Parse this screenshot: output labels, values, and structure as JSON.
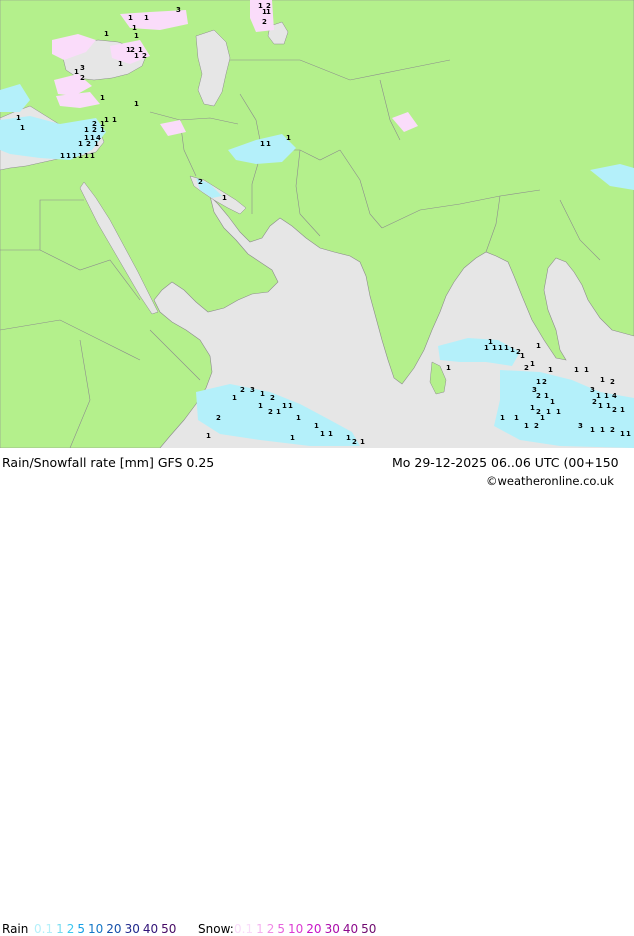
{
  "title": "Rain/Snowfall rate [mm] GFS 0.25",
  "valid_time": "Mo 29-12-2025 06..06 UTC (00+150",
  "credit": "©weatheronline.co.uk",
  "legend": {
    "rain_label": "Rain",
    "rain_values": [
      {
        "text": "0.1",
        "color": "#b4f0fa"
      },
      {
        "text": "1",
        "color": "#78dcf0"
      },
      {
        "text": "2",
        "color": "#3cc8f0"
      },
      {
        "text": "5",
        "color": "#14a0e6"
      },
      {
        "text": "10",
        "color": "#1478c8"
      },
      {
        "text": "20",
        "color": "#1450aa"
      },
      {
        "text": "30",
        "color": "#1e288c"
      },
      {
        "text": "40",
        "color": "#321478"
      },
      {
        "text": "50",
        "color": "#460a64"
      }
    ],
    "snow_label": "Snow:",
    "snow_values": [
      {
        "text": "0.1",
        "color": "#fadcfa"
      },
      {
        "text": "1",
        "color": "#f5b4f0"
      },
      {
        "text": "2",
        "color": "#f08ce6"
      },
      {
        "text": "5",
        "color": "#e664dc"
      },
      {
        "text": "10",
        "color": "#dc3cd2"
      },
      {
        "text": "20",
        "color": "#c814c8"
      },
      {
        "text": "30",
        "color": "#aa0aaa"
      },
      {
        "text": "40",
        "color": "#8c0a8c"
      },
      {
        "text": "50",
        "color": "#6e0a6e"
      }
    ]
  },
  "colors": {
    "land": "#b4f08c",
    "sea": "#e6e6e6",
    "border": "#8c8c8c",
    "rain": "#b4f0fa",
    "snow": "#fadcfa"
  },
  "map_labels": [
    "1",
    "2",
    "1",
    "1",
    "2",
    "1",
    "1",
    "3",
    "1",
    "1",
    "1",
    "2",
    "1",
    "1",
    "1",
    "2",
    "1",
    "1",
    "3",
    "2",
    "1",
    "1",
    "1",
    "1",
    "2",
    "1",
    "1",
    "1",
    "1",
    "2",
    "1",
    "1",
    "1",
    "4",
    "1",
    "2",
    "1",
    "1",
    "1",
    "1",
    "1",
    "1",
    "1",
    "1",
    "1",
    "1",
    "2",
    "1",
    "1",
    "1",
    "1",
    "1",
    "1",
    "1",
    "1",
    "2",
    "1",
    "1",
    "1",
    "2",
    "1",
    "1",
    "2",
    "3",
    "2",
    "1",
    "1",
    "1",
    "2",
    "1",
    "1",
    "1",
    "2",
    "1",
    "1",
    "1",
    "1",
    "2",
    "3",
    "1",
    "1",
    "4",
    "2",
    "1",
    "1",
    "2",
    "1",
    "3",
    "1",
    "1",
    "2",
    "1",
    "1",
    "1",
    "2",
    "1",
    "1",
    "1",
    "2",
    "1",
    "1",
    "1",
    "1",
    "1",
    "2",
    "1",
    "1",
    "1",
    "1",
    "2",
    "3",
    "2",
    "1",
    "1",
    "1"
  ]
}
